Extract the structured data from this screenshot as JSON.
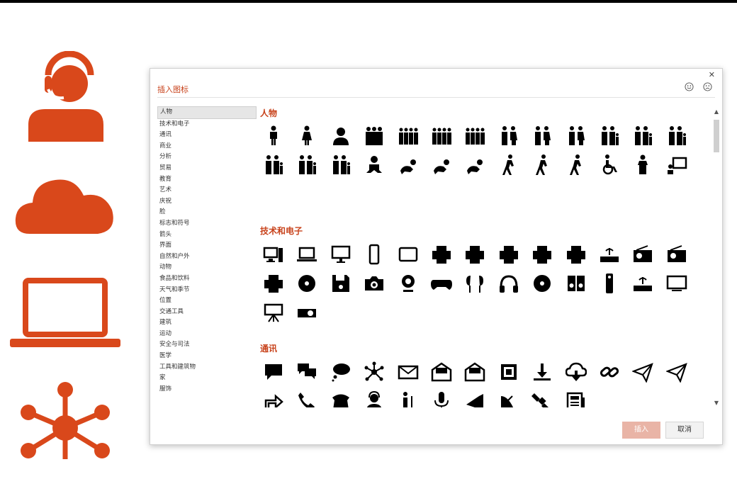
{
  "dialog": {
    "title": "插入图标",
    "close_label": "✕",
    "insert_label": "插入",
    "cancel_label": "取消"
  },
  "categories": [
    "人物",
    "技术和电子",
    "通讯",
    "商业",
    "分析",
    "贸易",
    "教育",
    "艺术",
    "庆祝",
    "脸",
    "标志和符号",
    "箭头",
    "界面",
    "自然和户外",
    "动物",
    "食品和饮料",
    "天气和季节",
    "位置",
    "交通工具",
    "建筑",
    "运动",
    "安全与司法",
    "医学",
    "工具和建筑物",
    "家",
    "服饰"
  ],
  "sections": [
    {
      "title": "人物"
    },
    {
      "title": "技术和电子"
    },
    {
      "title": "通讯"
    }
  ],
  "left_icons": [
    "headset-user-icon",
    "cloud-icon",
    "laptop-icon",
    "network-hub-icon"
  ],
  "colors": {
    "accent": "#d9481b",
    "title_text": "#c8431c",
    "insert_button": "#e9b4a6"
  }
}
